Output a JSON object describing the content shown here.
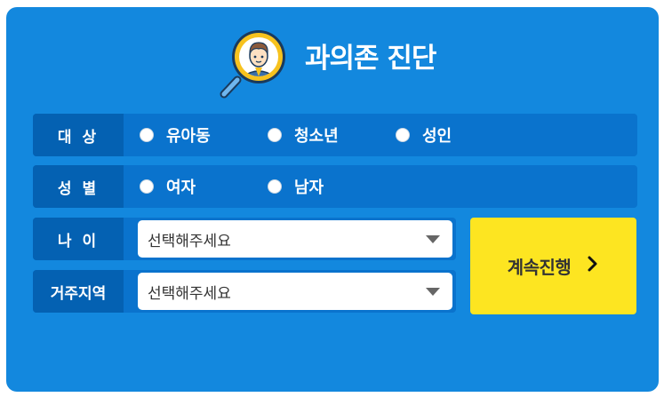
{
  "title": "과의존 진단",
  "target": {
    "label": "대 상",
    "options": [
      "유아동",
      "청소년",
      "성인"
    ]
  },
  "gender": {
    "label": "성 별",
    "options": [
      "여자",
      "남자"
    ]
  },
  "age": {
    "label": "나 이",
    "value": "선택해주세요"
  },
  "region": {
    "label": "거주지역",
    "value": "선택해주세요"
  },
  "continue_label": "계속진행",
  "colors": {
    "card_bg": "#1388de",
    "row_bg": "#0a73cd",
    "label_bg": "#0461b2",
    "button_bg": "#fde521"
  },
  "icons": {
    "logo": "magnifier-person-icon",
    "continue": "chevron-right-icon",
    "select": "caret-down-icon"
  }
}
